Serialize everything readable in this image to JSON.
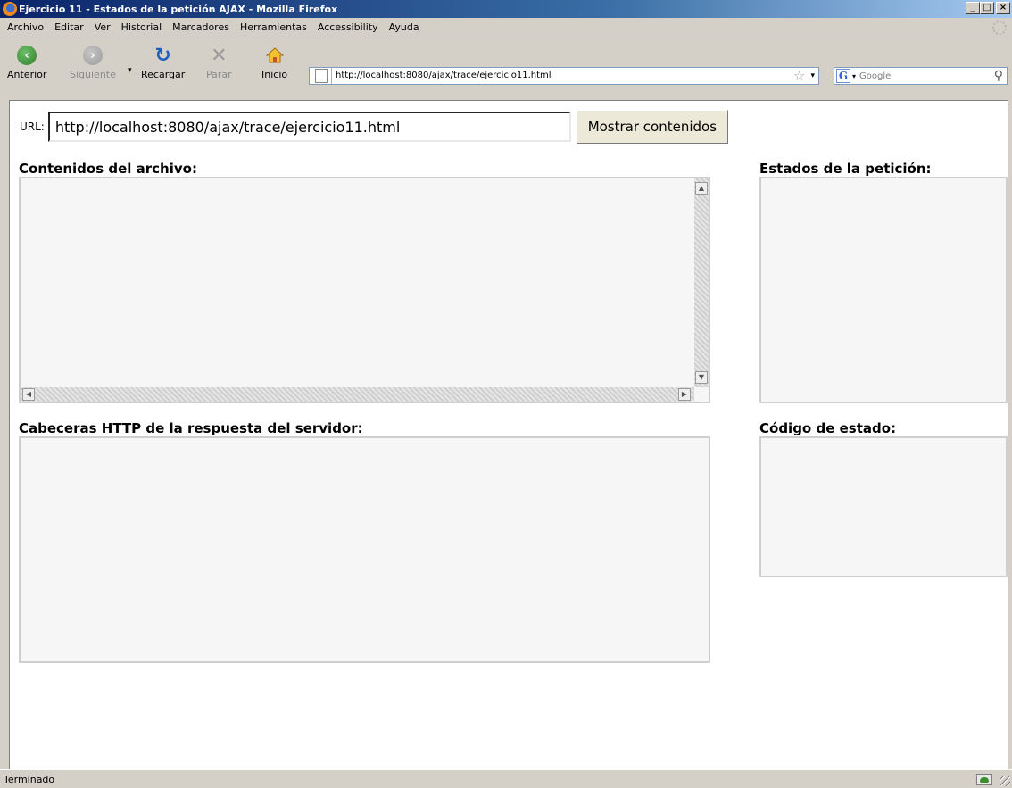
{
  "window": {
    "title": "Ejercicio 11 - Estados de la petición AJAX - Mozilla Firefox",
    "controls": [
      "_",
      "□",
      "×"
    ]
  },
  "menu": [
    {
      "label": "Archivo"
    },
    {
      "label": "Editar"
    },
    {
      "label": "Ver"
    },
    {
      "label": "Historial"
    },
    {
      "label": "Marcadores"
    },
    {
      "label": "Herramientas"
    },
    {
      "label": "Accessibility"
    },
    {
      "label": "Ayuda"
    }
  ],
  "toolbar": {
    "back_label": "Anterior",
    "forward_label": "Siguiente",
    "reload_label": "Recargar",
    "stop_label": "Parar",
    "home_label": "Inicio",
    "address": "http://localhost:8080/ajax/trace/ejercicio11.html",
    "search_placeholder": "Google"
  },
  "page": {
    "url_label": "URL:",
    "url_value": "http://localhost:8080/ajax/trace/ejercicio11.html",
    "show_button": "Mostrar contenidos",
    "contents_title": "Contenidos del archivo:",
    "states_title": "Estados de la petición:",
    "headers_title": "Cabeceras HTTP de la respuesta del servidor:",
    "status_code_title": "Código de estado:"
  },
  "statusbar": {
    "text": "Terminado"
  },
  "colors": {
    "titlebar_start": "#0a246a",
    "chrome": "#d4d0c8",
    "panel_bg": "#f6f6f6",
    "panel_border": "#cfcfcf"
  }
}
